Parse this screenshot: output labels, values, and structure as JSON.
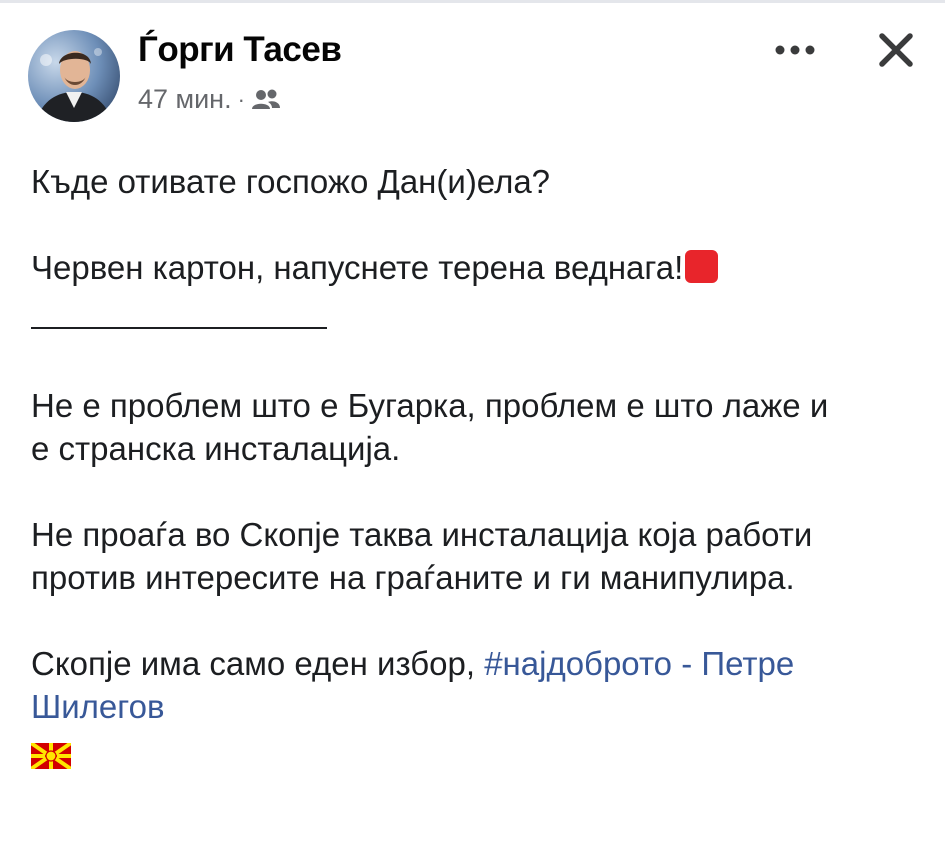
{
  "post": {
    "author": "Ѓорги Тасев",
    "time": "47 мин.",
    "separator_dot": "·",
    "audience_icon": "friends-icon",
    "more_icon": "more-horizontal-icon",
    "close_icon": "close-icon",
    "lines": {
      "l1": "Къде отивате госпожо Дан(и)ела?",
      "l2": "Червен картон, напуснете терена веднага!",
      "l3a": "Не е проблем што е Бугарка, проблем е што лаже и",
      "l3b": "е странска инсталација.",
      "l4a": "Не проаѓа во Скопје таква инсталација која работи",
      "l4b": "против интересите на граѓаните и ги манипулира.",
      "l5_text": "Скопје има само еден избор, ",
      "l5_hashtag": "#најдоброто",
      "l5_sep": " - ",
      "l5_name1": "Петре",
      "l5_name2": "Шилегов"
    },
    "emoji": {
      "red_square": "red-square-emoji",
      "flag": "north-macedonia-flag-emoji"
    }
  },
  "colors": {
    "text": "#1c1e21",
    "secondary": "#65676b",
    "link": "#385898",
    "red": "#e8252b",
    "flag_red": "#d20000",
    "flag_yellow": "#ffe600"
  }
}
